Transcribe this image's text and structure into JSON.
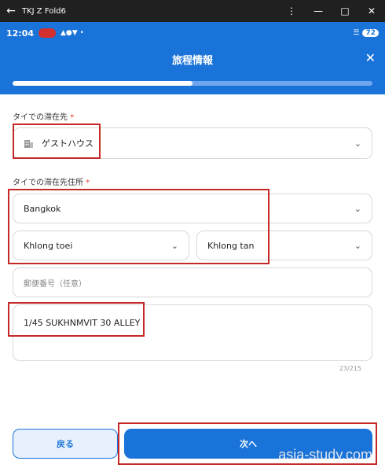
{
  "window": {
    "title": "TKJ Z Fold6"
  },
  "status_bar": {
    "time": "12:04",
    "battery": "72"
  },
  "header": {
    "title": "旅程情報",
    "progress_fraction": 0.5
  },
  "form": {
    "stay_type": {
      "label": "タイでの滞在先",
      "required_mark": "*",
      "value": "ゲストハウス"
    },
    "address": {
      "label": "タイでの滞在先住所",
      "required_mark": "*",
      "province": "Bangkok",
      "district": "Khlong toei",
      "subdistrict": "Khlong tan",
      "postal_placeholder": "郵便番号（任意）",
      "street": "1/45 SUKHNMVIT 30 ALLEY",
      "street_counter": "23/215"
    }
  },
  "buttons": {
    "back": "戻る",
    "next": "次へ"
  },
  "watermark": "asia-study.com",
  "colors": {
    "primary": "#1a73d9",
    "highlight": "#c62828"
  }
}
